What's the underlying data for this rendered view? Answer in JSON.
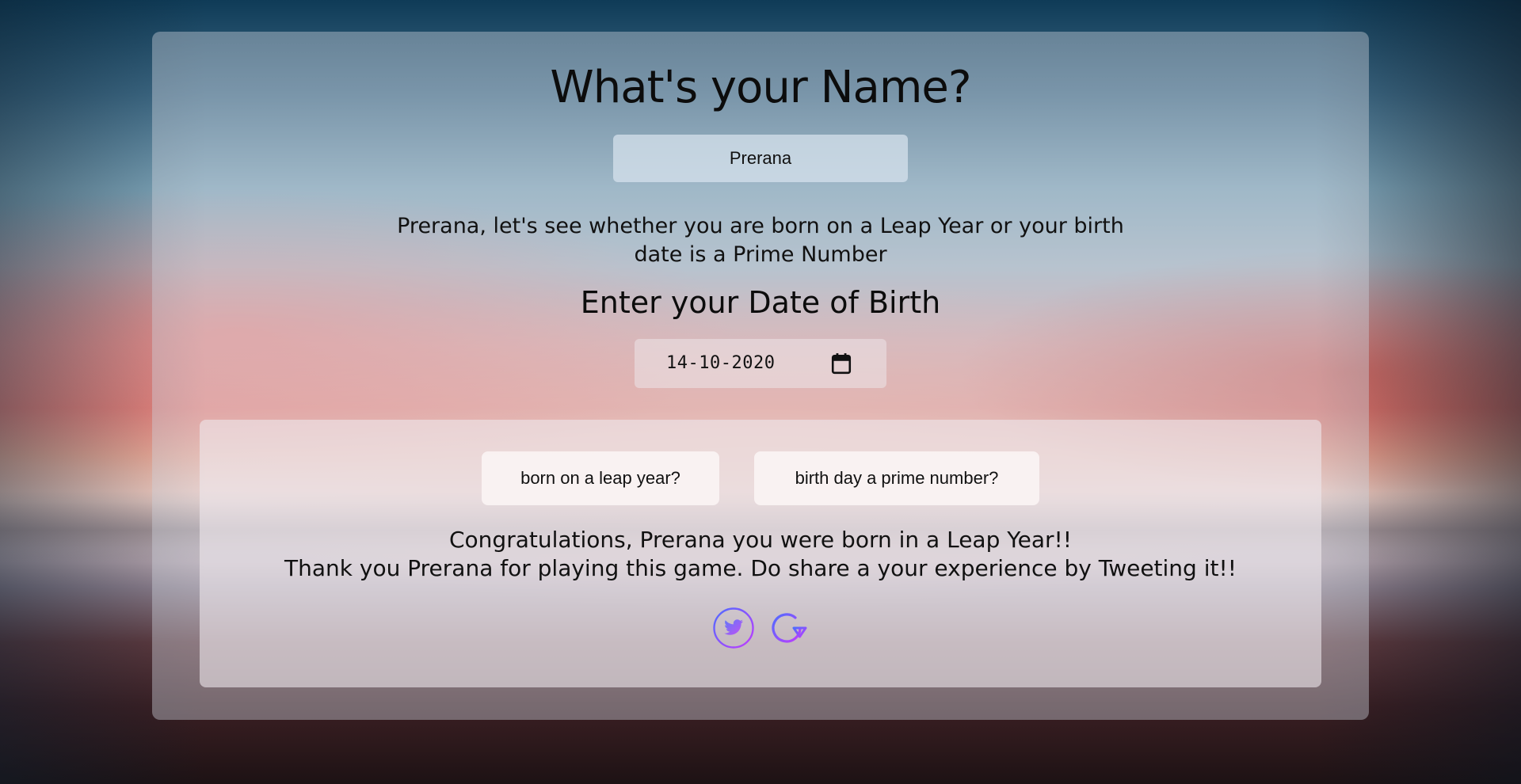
{
  "header": {
    "title": "What's your Name?"
  },
  "name_input": {
    "value": "Prerana"
  },
  "intro": {
    "text": "Prerana, let's see whether you are born on a Leap Year or your birth date is a Prime Number"
  },
  "dob": {
    "heading": "Enter your Date of Birth",
    "value": "14-10-2020",
    "icon": "calendar-icon"
  },
  "actions": {
    "leap_label": "born on a leap year?",
    "prime_label": "birth day a prime number?"
  },
  "result": {
    "line1": "Congratulations, Prerana you were born in a Leap Year!!",
    "line2": "Thank you Prerana for playing this game. Do share a your experience by Tweeting it!!"
  },
  "icons": {
    "tweet": "twitter-icon",
    "reset": "refresh-icon"
  },
  "colors": {
    "icon_gradient_start": "#4f6cff",
    "icon_gradient_end": "#c03cff"
  }
}
